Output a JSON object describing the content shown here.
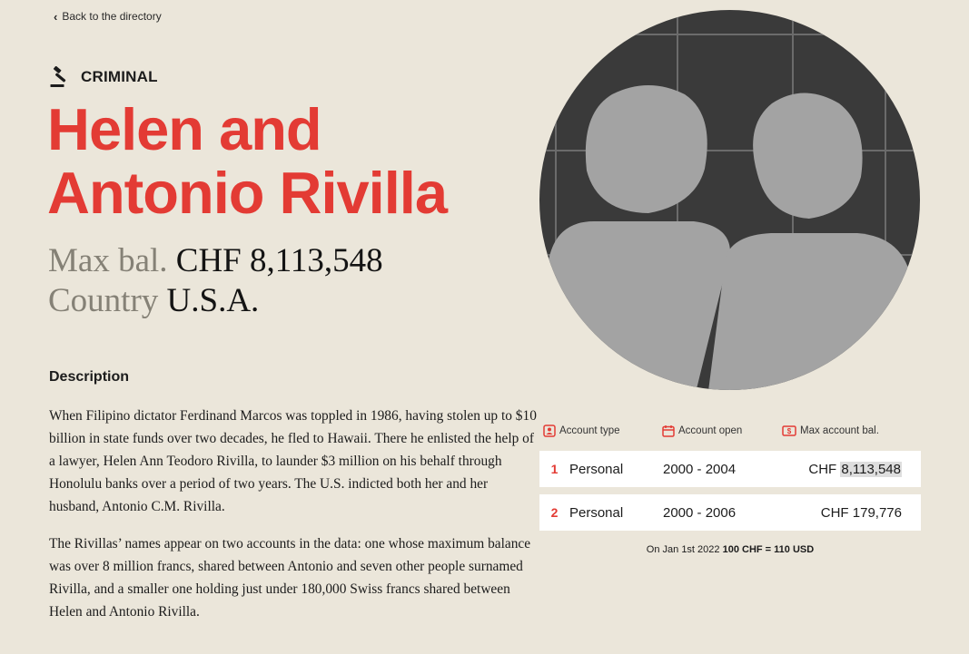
{
  "nav": {
    "back_label": "Back to the directory"
  },
  "profile": {
    "category": "CRIMINAL",
    "name_line1": "Helen and",
    "name_line2": "Antonio Rivilla",
    "max_balance_label": "Max bal.",
    "max_balance_value": "CHF 8,113,548",
    "country_label": "Country",
    "country_value": "U.S.A."
  },
  "description": {
    "heading": "Description",
    "paragraphs": [
      "When Filipino dictator Ferdinand Marcos was toppled in 1986, having stolen up to $10 billion in state funds over two decades, he fled to Hawaii. There he enlisted the help of a lawyer, Helen Ann Teodoro Rivilla, to launder $3 million on his behalf through Honolulu banks over a period of two years. The U.S. indicted both her and her husband, Antonio C.M. Rivilla.",
      "The Rivillas’ names appear on two accounts in the data: one whose maximum balance was over 8 million francs, shared between Antonio and seven other people surnamed Rivilla, and a smaller one holding just under 180,000 Swiss francs shared between Helen and Antonio Rivilla."
    ]
  },
  "accounts": {
    "headers": {
      "type": "Account type",
      "open": "Account open",
      "max_bal": "Max account bal."
    },
    "rows": [
      {
        "num": "1",
        "type": "Personal",
        "period": "2000 - 2004",
        "currency": "CHF",
        "balance": "8,113,548"
      },
      {
        "num": "2",
        "type": "Personal",
        "period": "2000 - 2006",
        "currency": "CHF",
        "balance": "179,776"
      }
    ],
    "fx_prefix": "On Jan 1st 2022",
    "fx_rate": "100 CHF = 110 USD"
  },
  "colors": {
    "accent": "#e33b34",
    "background": "#ebe6da",
    "portrait_bg": "#3a3a3a",
    "silhouette": "#a3a3a3"
  },
  "icons": {
    "back": "chevron-left-icon",
    "category": "gavel-icon",
    "account_type": "person-card-icon",
    "account_open": "calendar-icon",
    "max_bal": "money-icon"
  }
}
